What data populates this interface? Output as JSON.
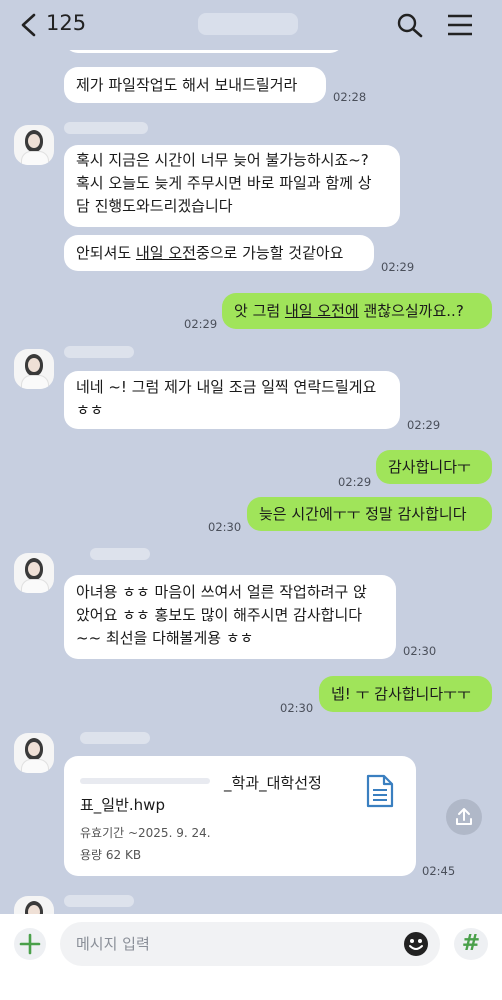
{
  "header": {
    "back_count": "125"
  },
  "messages": {
    "m1": {
      "text": "제가 파일작업도 해서 보내드릴거라",
      "time": "02:28"
    },
    "m2": {
      "line1": "혹시 지금은 시간이 너무 늦어 불가능하시죠~?",
      "line2": "혹시 오늘도 늦게 주무시면 바로 파일과 함께 상",
      "line3": "담 진행도와드리겠습니다"
    },
    "m3": {
      "pre": "안되셔도 ",
      "u1": "내일 오전",
      "post": "중으로 가능할 것같아요",
      "time": "02:29"
    },
    "m4": {
      "pre": "앗 그럼 ",
      "u1": "내일 오전에",
      "post": " 괜찮으실까요..?",
      "time": "02:29"
    },
    "m5": {
      "line1": "네네 ~! 그럼 제가 내일 조금 일찍 연락드릴게요",
      "line2": "ㅎㅎ",
      "time": "02:29"
    },
    "m6": {
      "text": "감사합니다ㅜ",
      "time": "02:29"
    },
    "m7": {
      "text": "늦은 시간에ㅜㅜ 정말 감사합니다",
      "time": "02:30"
    },
    "m8": {
      "line1": "아녀용 ㅎㅎ 마음이 쓰여서 얼른 작업하려구 앉",
      "line2": "았어요 ㅎㅎ 홍보도 많이 해주시면 감사합니다",
      "line3": "~~ 최선을 다해볼게용 ㅎㅎ",
      "time": "02:30"
    },
    "m9": {
      "text": "넵! ㅜ 감사합니다ㅜㅜ",
      "time": "02:30"
    },
    "file": {
      "name_part1": "_학과_대학선정",
      "name_part2": "표_일반.hwp",
      "expiry": "유효기간 ~2025. 9. 24.",
      "size": "용량 62 KB",
      "time": "02:45"
    }
  },
  "input": {
    "placeholder": "메시지 입력"
  },
  "icons": {
    "back": "chevron-left-icon",
    "search": "search-icon",
    "menu": "hamburger-menu-icon",
    "document": "document-icon",
    "share": "share-icon",
    "plus": "plus-icon",
    "emoji": "emoji-icon",
    "hash": "hash-icon"
  },
  "colors": {
    "background": "#c7cfe0",
    "outgoing_bubble": "#a0e45a",
    "incoming_bubble": "#ffffff"
  },
  "hash_label": "#"
}
